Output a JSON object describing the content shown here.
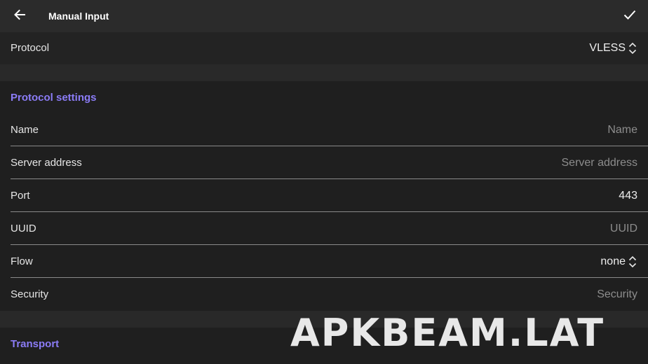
{
  "header": {
    "title": "Manual Input",
    "back_icon": "arrow-left-icon",
    "confirm_icon": "check-icon"
  },
  "protocol": {
    "label": "Protocol",
    "value": "VLESS",
    "icon": "unfold-icon"
  },
  "protocol_settings": {
    "title": "Protocol settings",
    "fields": [
      {
        "label": "Name",
        "value": "",
        "placeholder": "Name"
      },
      {
        "label": "Server address",
        "value": "",
        "placeholder": "Server address"
      },
      {
        "label": "Port",
        "value": "443",
        "placeholder": ""
      },
      {
        "label": "UUID",
        "value": "",
        "placeholder": "UUID"
      },
      {
        "label": "Flow",
        "value": "none",
        "placeholder": ""
      },
      {
        "label": "Security",
        "value": "",
        "placeholder": "Security"
      }
    ]
  },
  "transport": {
    "title": "Transport"
  },
  "watermark": "APKBEAM.LAT",
  "colors": {
    "background": "#1f1f1f",
    "topbar": "#2b2b2b",
    "accent": "#8b7cf6",
    "placeholder": "#8d8d8d",
    "divider": "#8a8a8a"
  }
}
